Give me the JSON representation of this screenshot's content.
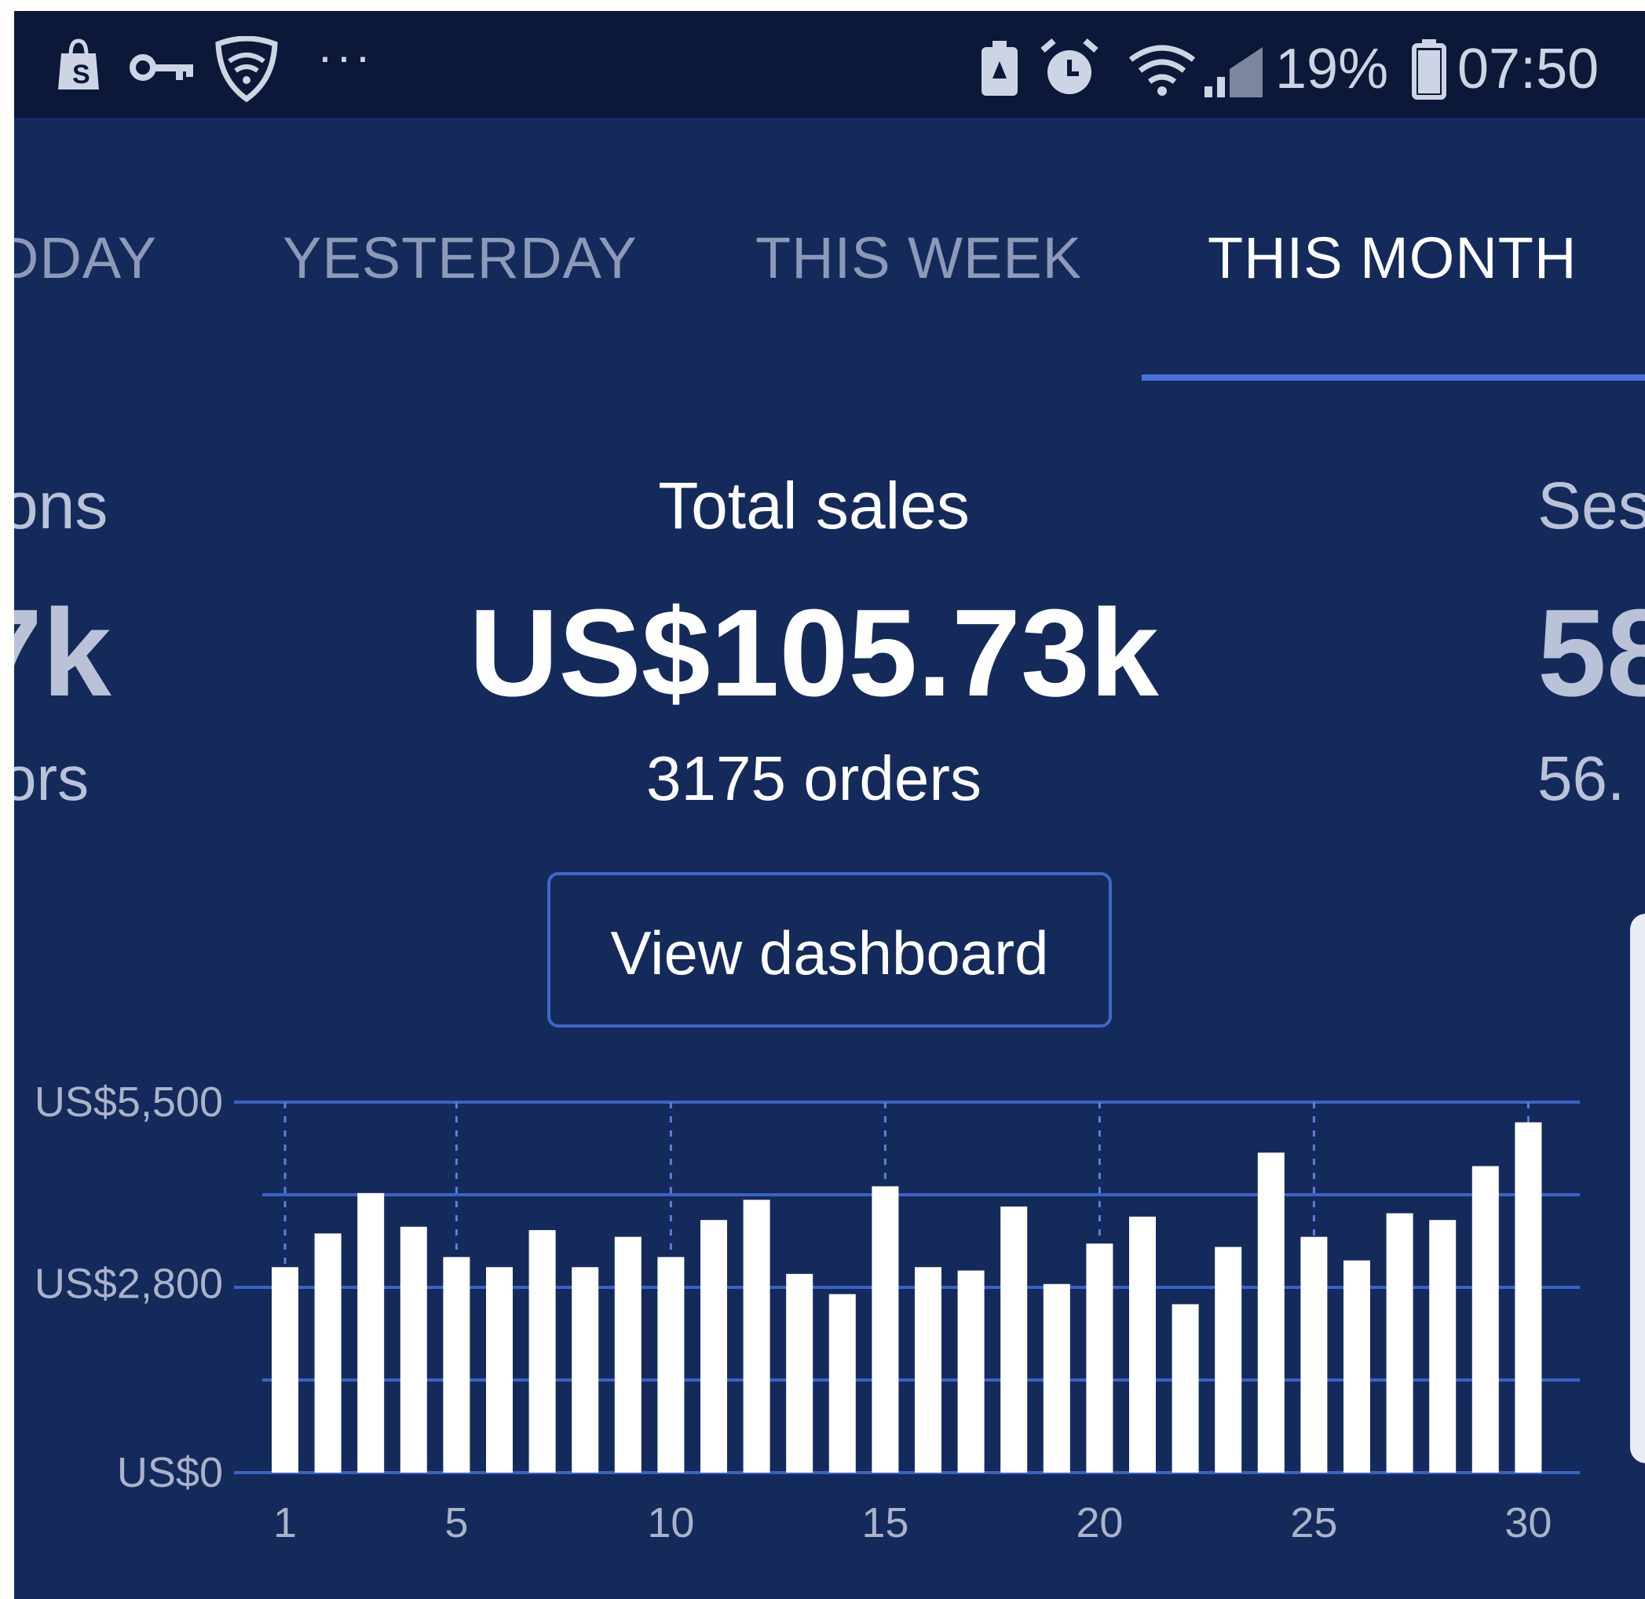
{
  "status_bar": {
    "icons_left": [
      "shopify-bag-icon",
      "vpn-key-icon",
      "shield-wifi-icon",
      "more-icon"
    ],
    "icons_right": [
      "battery-saver-icon",
      "alarm-icon",
      "wifi-icon",
      "signal-icon",
      "battery-icon"
    ],
    "more": "···",
    "battery_percent": "19%",
    "time": "07:50"
  },
  "tabs": [
    {
      "label": "DDAY",
      "active": false
    },
    {
      "label": "YESTERDAY",
      "active": false
    },
    {
      "label": "THIS WEEK",
      "active": false
    },
    {
      "label": "THIS MONTH",
      "active": true
    }
  ],
  "left_metric": {
    "label": "ons",
    "value": "7k",
    "sub": "ors"
  },
  "main_metric": {
    "label": "Total sales",
    "value": "US$105.73k",
    "sub": "3175 orders"
  },
  "right_metric": {
    "label": "Ses",
    "value": "58",
    "sub": "56."
  },
  "dashboard_button": "View dashboard",
  "colors": {
    "background": "#142a5b",
    "status_bar": "#0b1838",
    "accent": "#4a73d6",
    "bar": "#ffffff"
  },
  "chart_data": {
    "type": "bar",
    "x": [
      1,
      2,
      3,
      4,
      5,
      6,
      7,
      8,
      9,
      10,
      11,
      12,
      13,
      14,
      15,
      16,
      17,
      18,
      19,
      20,
      21,
      22,
      23,
      24,
      25,
      26,
      27,
      28,
      29,
      30
    ],
    "values": [
      3050,
      3550,
      4150,
      3650,
      3200,
      3050,
      3600,
      3050,
      3500,
      3200,
      3750,
      4050,
      2950,
      2650,
      4250,
      3050,
      3000,
      3950,
      2800,
      3400,
      3800,
      2500,
      3350,
      4750,
      3500,
      3150,
      3850,
      3750,
      4550,
      5200
    ],
    "x_ticks": [
      "1",
      "5",
      "10",
      "15",
      "20",
      "25",
      "30"
    ],
    "y_ticks": [
      "US$0",
      "US$2,800",
      "US$5,500"
    ],
    "ylim": [
      0,
      5500
    ],
    "grid": true
  }
}
